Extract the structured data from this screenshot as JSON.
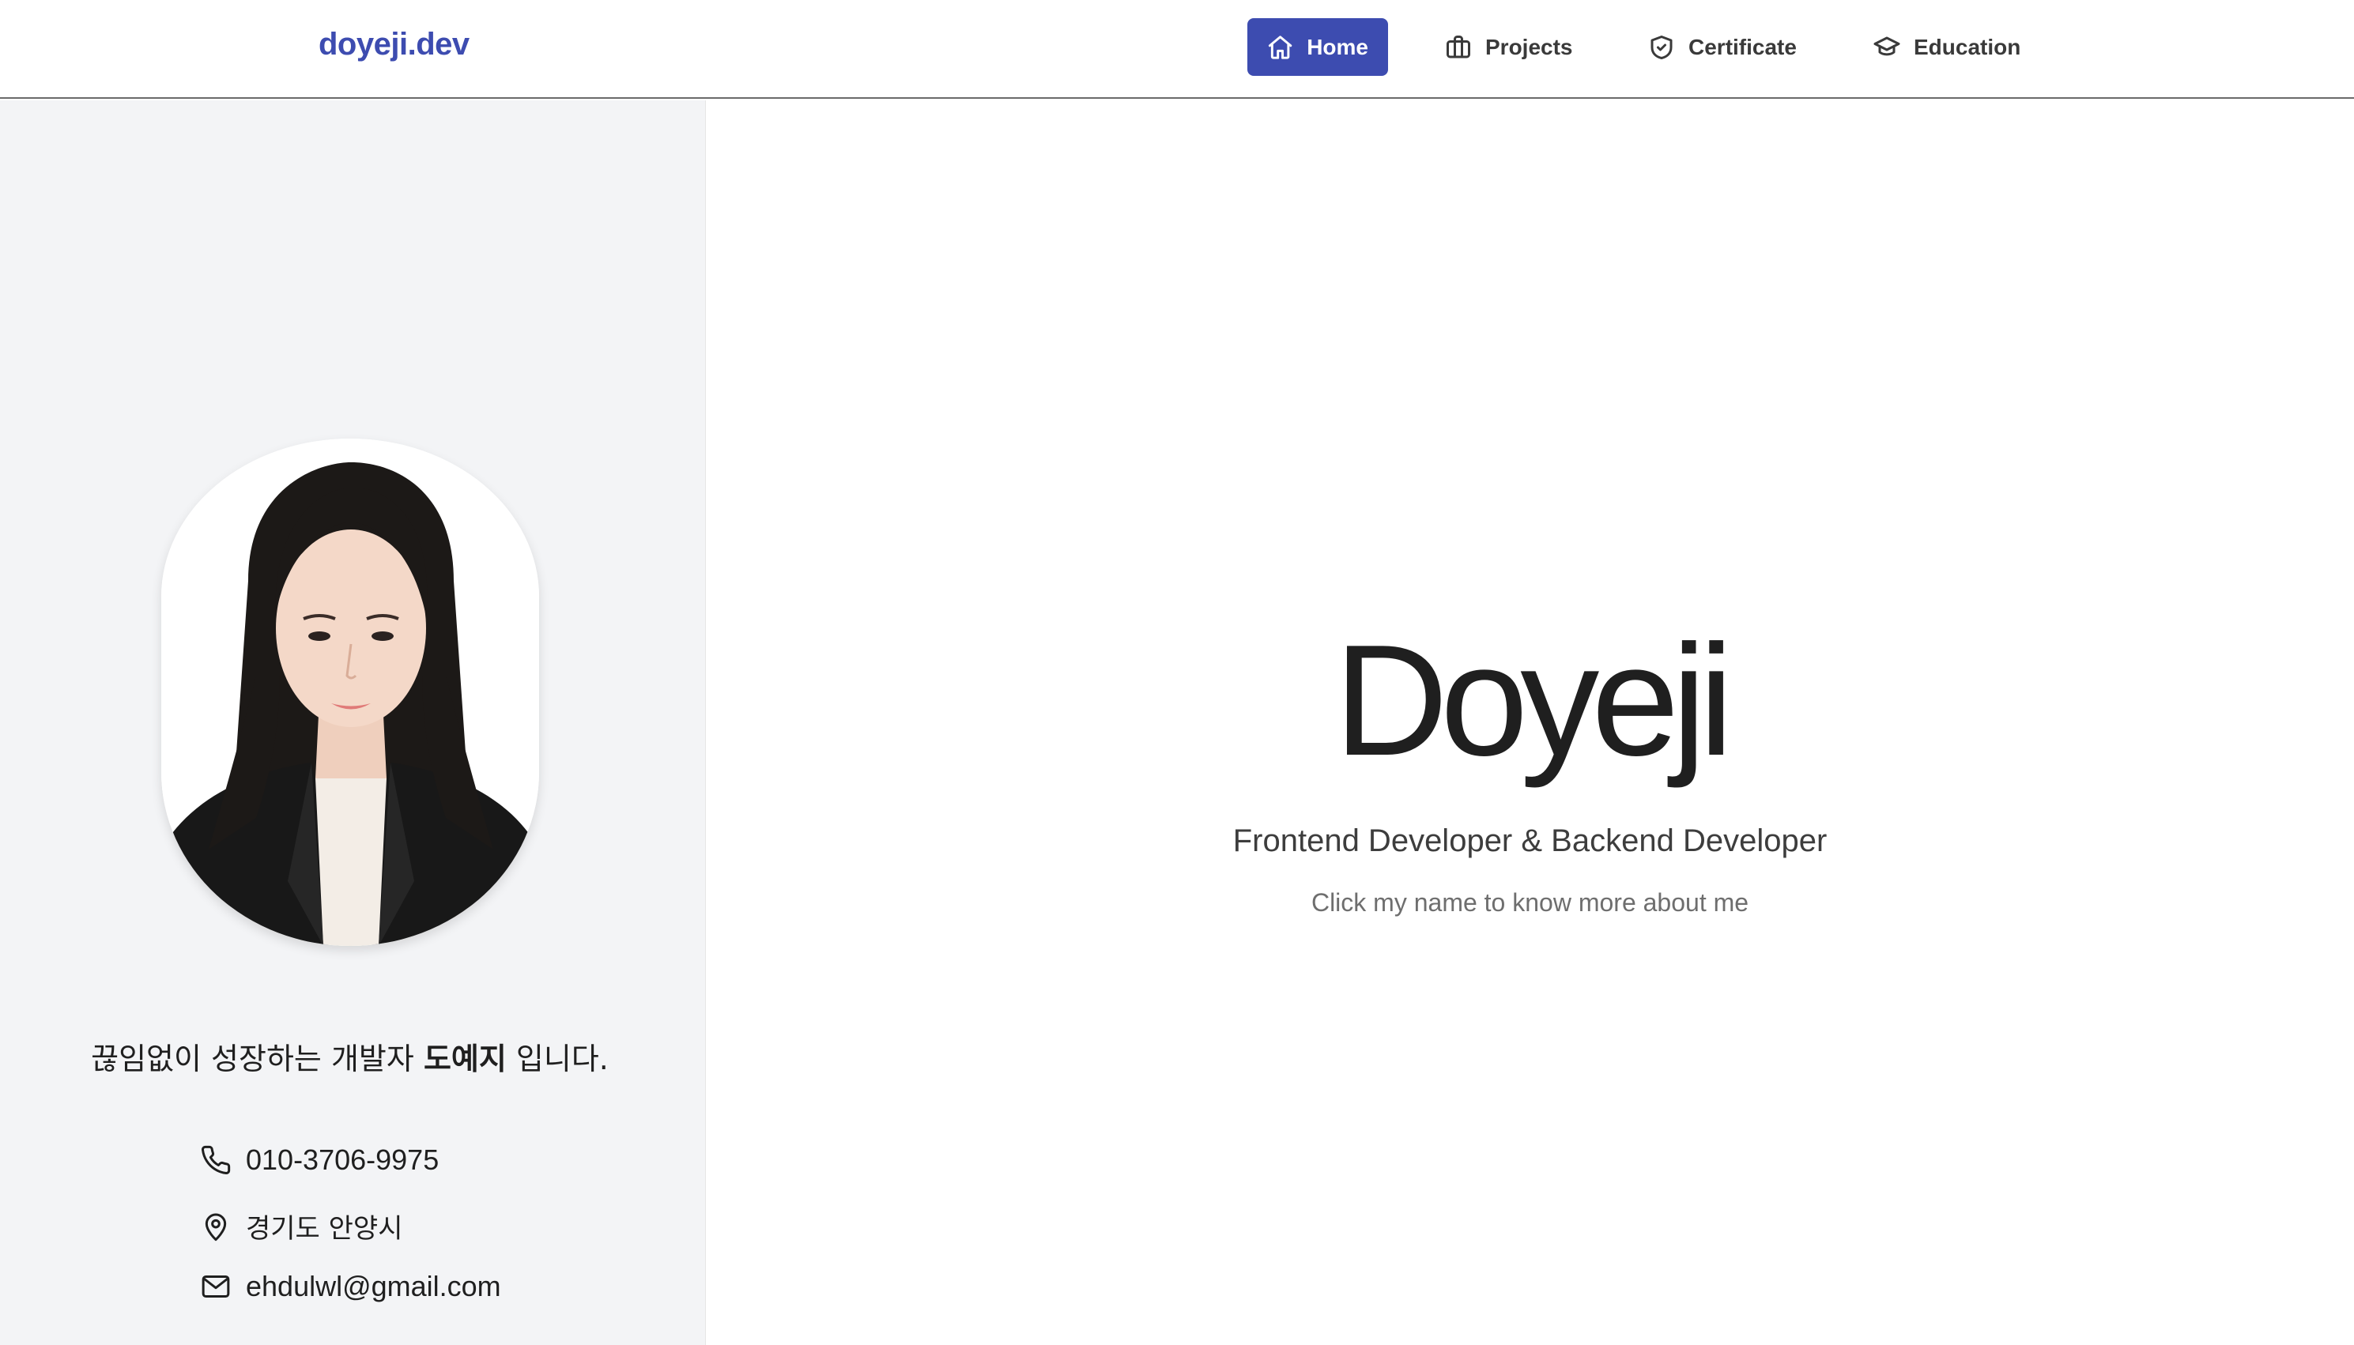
{
  "header": {
    "brand": "doyeji.dev",
    "nav": [
      {
        "label": "Home",
        "icon": "home-icon",
        "active": true
      },
      {
        "label": "Projects",
        "icon": "briefcase-icon",
        "active": false
      },
      {
        "label": "Certificate",
        "icon": "shield-check-icon",
        "active": false
      },
      {
        "label": "Education",
        "icon": "graduation-cap-icon",
        "active": false
      }
    ]
  },
  "sidebar": {
    "tagline_prefix": "끊임없이 성장하는 개발자 ",
    "tagline_name": "도예지",
    "tagline_suffix": " 입니다.",
    "contacts": {
      "phone": "010-3706-9975",
      "location": "경기도 안양시",
      "email": "ehdulwl@gmail.com"
    }
  },
  "main": {
    "name": "Doyeji",
    "subtitle": "Frontend Developer & Backend Developer",
    "hint": "Click my name to know more about me"
  },
  "colors": {
    "accent": "#3d4cb0",
    "sidebar_bg": "#f3f4f6",
    "text": "#1f1f1f",
    "muted": "#6e6e6e"
  }
}
